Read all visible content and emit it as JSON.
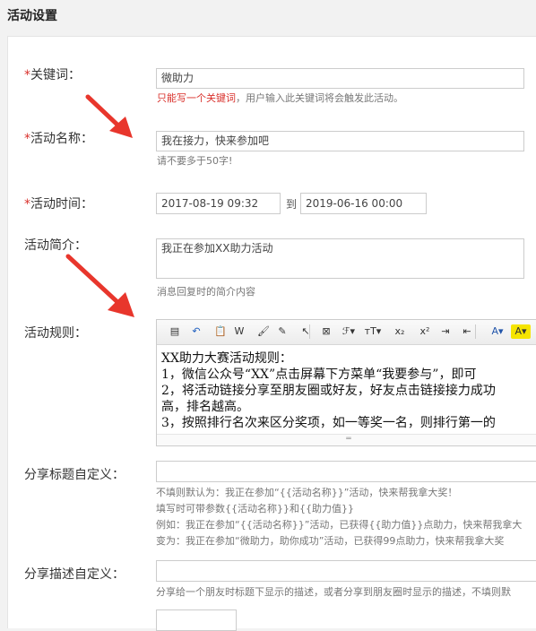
{
  "page": {
    "title": "活动设置"
  },
  "keyword": {
    "label": "关键词：",
    "value": "微助力",
    "hint_red": "只能写一个关键词",
    "hint_rest": "，用户输入此关键词将会触发此活动。"
  },
  "name": {
    "label": "活动名称：",
    "value": "我在接力，快来参加吧",
    "hint": "请不要多于50字!"
  },
  "time": {
    "label": "活动时间：",
    "start": "2017-08-19 09:32",
    "to": "到",
    "end": "2019-06-16 00:00"
  },
  "intro": {
    "label": "活动简介：",
    "value": "我正在参加XX助力活动",
    "hint": "消息回复时的简介内容"
  },
  "rules": {
    "label": "活动规则：",
    "toolbar": [
      {
        "name": "source-icon",
        "glyph": "▤"
      },
      {
        "name": "undo-icon",
        "glyph": "↶"
      },
      {
        "name": "paste-icon",
        "glyph": "📋"
      },
      {
        "name": "paste-word-icon",
        "glyph": "W"
      },
      {
        "name": "format-brush-icon",
        "glyph": "🖌"
      },
      {
        "name": "paste-text-icon",
        "glyph": "✎"
      },
      {
        "name": "select-icon",
        "glyph": "↖"
      },
      {
        "name": "clear-format-icon",
        "glyph": "⊠"
      },
      {
        "name": "font-family-icon",
        "glyph": "ℱ▾"
      },
      {
        "name": "font-size-icon",
        "glyph": "тT▾"
      },
      {
        "name": "subscript-icon",
        "glyph": "x₂"
      },
      {
        "name": "superscript-icon",
        "glyph": "x²"
      },
      {
        "name": "indent-icon",
        "glyph": "⇥"
      },
      {
        "name": "outdent-icon",
        "glyph": "⇤"
      },
      {
        "name": "font-color-icon",
        "glyph": "A▾"
      },
      {
        "name": "highlight-icon",
        "glyph": "A▾"
      }
    ],
    "lines": [
      "XX助力大赛活动规则：",
      "1，微信公众号“XX”点击屏幕下方菜单“我要参与”，即可",
      "2，将活动链接分享至朋友圈或好友，好友点击链接接力成功",
      "高，排名越高。",
      "3，按照排行名次来区分奖项，如一等奖一名，则排行第一的"
    ],
    "resize_glyph": "═"
  },
  "share_title": {
    "label": "分享标题自定义：",
    "value": "",
    "hints": [
      "不填则默认为：我正在参加“{{活动名称}}”活动，快来帮我拿大奖！",
      "填写时可带参数{{活动名称}}和{{助力值}}",
      "例如：我正在参加“{{活动名称}}”活动，已获得{{助力值}}点助力，快来帮我拿大",
      "变为：我正在参加“微助力，助你成功”活动，已获得99点助力，快来帮我拿大奖"
    ]
  },
  "share_desc": {
    "label": "分享描述自定义：",
    "value": "",
    "hint": "分享给一个朋友时标题下显示的描述，或者分享到朋友圈时显示的描述，不填则默"
  },
  "colors": {
    "required": "#d9302b",
    "arrow": "#e8362c"
  }
}
